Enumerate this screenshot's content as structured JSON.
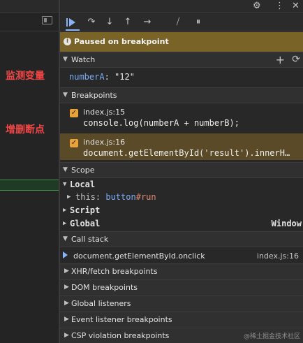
{
  "left": {
    "annotation_watch": "监测变量",
    "annotation_breakpoints": "增删断点"
  },
  "toolbar": {
    "icons": [
      "resume-icon",
      "step-over-icon",
      "step-into-icon",
      "step-out-icon",
      "step-icon",
      "deactivate-breakpoints-icon",
      "pause-on-exceptions-icon"
    ]
  },
  "banner": {
    "text": "Paused on breakpoint"
  },
  "watch": {
    "title": "Watch",
    "items": [
      {
        "name": "numberA",
        "value": "\"12\""
      }
    ]
  },
  "breakpoints": {
    "title": "Breakpoints",
    "items": [
      {
        "file": "index.js:15",
        "code": "console.log(numberA + numberB);",
        "checked": true
      },
      {
        "file": "index.js:16",
        "code": "document.getElementById('result').innerH…",
        "checked": true
      }
    ]
  },
  "scope": {
    "title": "Scope",
    "local": "Local",
    "this_key": "this:",
    "this_tag": "button",
    "this_id": "#run",
    "script": "Script",
    "global": "Global",
    "global_value": "Window"
  },
  "callstack": {
    "title": "Call stack",
    "frames": [
      {
        "name": "document.getElementById.onclick",
        "location": "index.js:16"
      }
    ]
  },
  "collapsed_sections": [
    "XHR/fetch breakpoints",
    "DOM breakpoints",
    "Global listeners",
    "Event listener breakpoints",
    "CSP violation breakpoints"
  ],
  "watermark": "@稀土掘金技术社区",
  "colors": {
    "banner_bg": "#7a6327",
    "breakpoint_checkbox": "#e8a23a",
    "accent_blue": "#8ab4f8",
    "annotation_red": "#f24646"
  }
}
